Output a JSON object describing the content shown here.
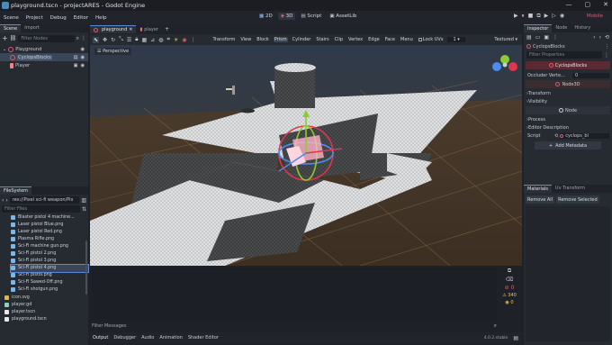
{
  "window": {
    "title": "playground.tscn - projectARES - Godot Engine",
    "controls": {
      "minimize": "—",
      "maximize": "▢",
      "close": "✕"
    }
  },
  "menu": [
    "Scene",
    "Project",
    "Debug",
    "Editor",
    "Help"
  ],
  "workspaces": [
    "2D",
    "3D",
    "Script",
    "AssetLib"
  ],
  "active_workspace": "3D",
  "run_target": "Mobile",
  "scene_dock": {
    "tabs": [
      "Scene",
      "Import"
    ],
    "filter_placeholder": "Filter Nodes",
    "tree": [
      {
        "label": "Playground",
        "indent": 0,
        "icon_color": "#e05a6c"
      },
      {
        "label": "CyclopsBlocks",
        "indent": 1,
        "icon_color": "#e05a6c",
        "selected": true
      },
      {
        "label": "Player",
        "indent": 1,
        "icon_color": "#fc7f7f"
      }
    ]
  },
  "filesystem_dock": {
    "tab": "FileSystem",
    "path": "res://Pixel sci-fi weapon/Pix",
    "filter_placeholder": "Filter Files",
    "items": [
      {
        "label": "Blaster pistol 4 machine...",
        "kind": "img"
      },
      {
        "label": "Laser pistol Blue.png",
        "kind": "img"
      },
      {
        "label": "Laser pistol Red.png",
        "kind": "img"
      },
      {
        "label": "Plasma Rifle.png",
        "kind": "img"
      },
      {
        "label": "Sci-Fi machine gun.png",
        "kind": "img"
      },
      {
        "label": "Sci-Fi pistol 2.png",
        "kind": "img"
      },
      {
        "label": "Sci-Fi pistol 3.png",
        "kind": "img"
      },
      {
        "label": "Sci-Fi pistol 4.png",
        "kind": "img",
        "selected": true
      },
      {
        "label": "Sci-Fi pistol.png",
        "kind": "img"
      },
      {
        "label": "Sci-Fi Sawed-Off.png",
        "kind": "img"
      },
      {
        "label": "Sci-Fi shotgun.png",
        "kind": "img"
      },
      {
        "label": "icon.svg",
        "kind": "svg"
      },
      {
        "label": "player.gd",
        "kind": "gd"
      },
      {
        "label": "player.tscn",
        "kind": "tscn"
      },
      {
        "label": "playground.tscn",
        "kind": "tscn"
      }
    ]
  },
  "editor_tabs": [
    {
      "label": "playground",
      "active": true
    },
    {
      "label": "player",
      "active": false
    }
  ],
  "viewport_toolbar": {
    "transform_label": "Transform",
    "view_label": "View",
    "modes": [
      "Block",
      "Prism",
      "Cylinder",
      "Stairs",
      "Clip",
      "Vertex",
      "Edge",
      "Face",
      "Menu"
    ],
    "active_mode": "Prism",
    "lock_uvs_label": "Lock UVs",
    "snap_value": "1",
    "shading": "Textured"
  },
  "viewport": {
    "view_label": "Perspective"
  },
  "bottom_panel": {
    "filter_placeholder": "Filter Messages",
    "tabs": [
      "Output",
      "Debugger",
      "Audio",
      "Animation",
      "Shader Editor"
    ],
    "version": "4.0.2.stable",
    "counters": [
      "0",
      "340",
      "0"
    ]
  },
  "inspector": {
    "tabs": [
      "Inspector",
      "Node",
      "History"
    ],
    "object_name": "CyclopsBlocks",
    "filter_placeholder": "Filter Properties",
    "header": "CyclopsBlocks",
    "occluder_label": "Occluder Verte...",
    "occluder_value": "0",
    "section_node3d": "Node3D",
    "groups": [
      "Transform",
      "Visibility"
    ],
    "section_node": "Node",
    "groups2": [
      "Process",
      "Editor Description"
    ],
    "script_label": "Script",
    "script_value": "cyclops_bl",
    "add_metadata": "Add Metadata"
  },
  "materials_dock": {
    "tabs": [
      "Materials",
      "Uv Transform"
    ],
    "remove_all": "Remove All",
    "remove_selected": "Remove Selected"
  },
  "colors": {
    "accent": "#5b8bd6",
    "brand": "#478cbf",
    "node_red": "#e05a6c",
    "axis_x": "#e0344f",
    "axis_y": "#8ccb2e",
    "axis_z": "#4a8cf0"
  }
}
